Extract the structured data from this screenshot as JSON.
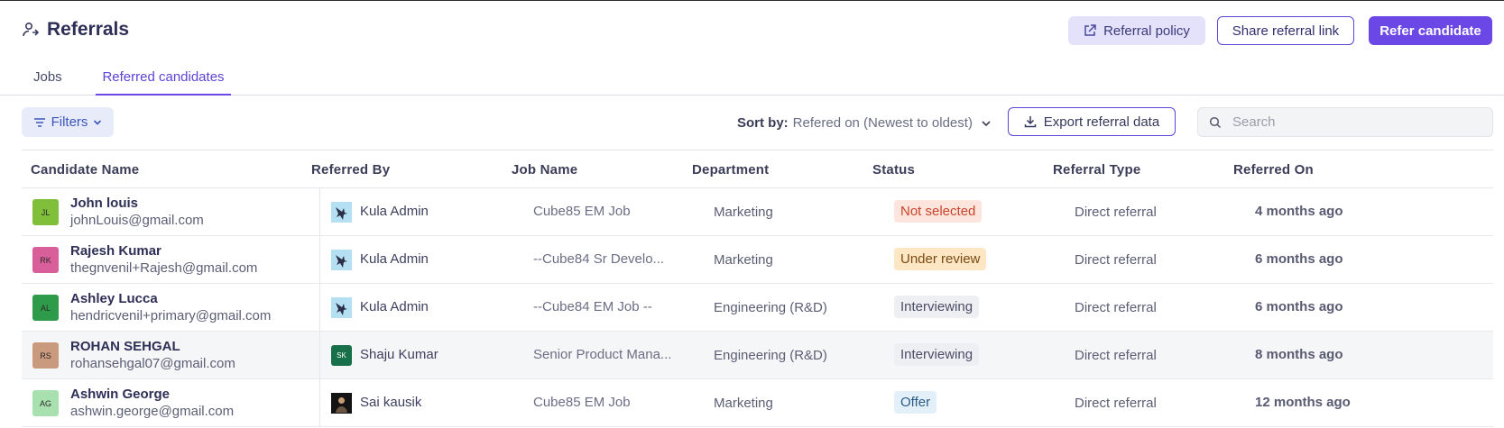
{
  "header": {
    "title": "Referrals",
    "policy_label": "Referral policy",
    "share_label": "Share referral link",
    "refer_label": "Refer candidate"
  },
  "tabs": [
    {
      "label": "Jobs",
      "active": false
    },
    {
      "label": "Referred candidates",
      "active": true
    }
  ],
  "toolbar": {
    "filters_label": "Filters",
    "sort_label": "Sort by:",
    "sort_value": "Refered on (Newest to oldest)",
    "export_label": "Export referral data",
    "search_placeholder": "Search"
  },
  "table": {
    "columns": [
      "Candidate Name",
      "Referred By",
      "Job Name",
      "Department",
      "Status",
      "Referral Type",
      "Referred On"
    ],
    "rows": [
      {
        "initials": "JL",
        "avatar_color": "#7fbf3a",
        "name": "John louis",
        "email": "johnLouis@gmail.com",
        "referrer": "Kula Admin",
        "referrer_avatar": "bird",
        "job": "Cube85 EM Job",
        "department": "Marketing",
        "status": "Not selected",
        "status_bg": "#fde4dc",
        "status_fg": "#c9442a",
        "referral_type": "Direct referral",
        "referred_on": "4 months ago"
      },
      {
        "initials": "RK",
        "avatar_color": "#d85f9a",
        "name": "Rajesh Kumar",
        "email": "thegnvenil+Rajesh@gmail.com",
        "referrer": "Kula Admin",
        "referrer_avatar": "bird",
        "job": "--Cube84 Sr Develo...",
        "department": "Marketing",
        "status": "Under review",
        "status_bg": "#fde6c4",
        "status_fg": "#7a4b12",
        "referral_type": "Direct referral",
        "referred_on": "6 months ago"
      },
      {
        "initials": "AL",
        "avatar_color": "#2e9b4a",
        "name": "Ashley Lucca",
        "email": "hendricvenil+primary@gmail.com",
        "referrer": "Kula Admin",
        "referrer_avatar": "bird",
        "job": "--Cube84 EM Job --",
        "department": "Engineering (R&D)",
        "status": "Interviewing",
        "status_bg": "#eeeff3",
        "status_fg": "#4a4d66",
        "referral_type": "Direct referral",
        "referred_on": "6 months ago"
      },
      {
        "initials": "RS",
        "avatar_color": "#c99a7e",
        "name": "ROHAN SEHGAL",
        "email": "rohansehgal07@gmail.com",
        "referrer": "Shaju Kumar",
        "referrer_avatar": "SK",
        "job": "Senior Product Mana...",
        "department": "Engineering (R&D)",
        "status": "Interviewing",
        "status_bg": "#eeeff3",
        "status_fg": "#4a4d66",
        "referral_type": "Direct referral",
        "referred_on": "8 months ago"
      },
      {
        "initials": "AG",
        "avatar_color": "#a8e0b0",
        "name": "Ashwin George",
        "email": "ashwin.george@gmail.com",
        "referrer": "Sai kausik",
        "referrer_avatar": "photo",
        "job": "Cube85 EM Job",
        "department": "Marketing",
        "status": "Offer",
        "status_bg": "#e3f0f9",
        "status_fg": "#2c5c86",
        "referral_type": "Direct referral",
        "referred_on": "12 months ago"
      }
    ]
  },
  "colors": {
    "accent": "#6b47e6",
    "accent_soft": "#e4e2fb"
  }
}
